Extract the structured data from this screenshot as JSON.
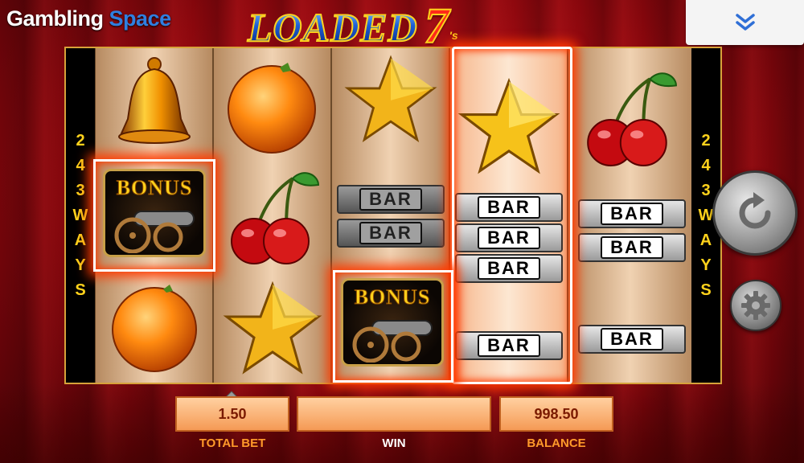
{
  "header": {
    "brand_word1": "Gambling",
    "brand_word2": "Space",
    "logo_word": "LOADED",
    "logo_seven": "7",
    "logo_suffix": "'s"
  },
  "ways": {
    "left": [
      "2",
      "4",
      "3",
      "W",
      "A",
      "Y",
      "S"
    ],
    "right": [
      "2",
      "4",
      "3",
      "W",
      "A",
      "Y",
      "S"
    ]
  },
  "reels": [
    {
      "symbols": [
        "bell",
        "bonus",
        "orange"
      ]
    },
    {
      "symbols": [
        "orange",
        "cherry",
        "star"
      ]
    },
    {
      "symbols": [
        "star",
        "bar-double",
        "bonus"
      ]
    },
    {
      "symbols": [
        "star",
        "bar-triple",
        "bar"
      ]
    },
    {
      "symbols": [
        "cherry",
        "bar-double",
        "bar"
      ]
    }
  ],
  "symbols": {
    "bonus_label": "BONUS",
    "bar_label": "BAR"
  },
  "bottom_bar": {
    "total_bet_value": "1.50",
    "total_bet_label": "TOTAL BET",
    "win_value": "",
    "win_label": "WIN",
    "balance_value": "998.50",
    "balance_label": "BALANCE"
  },
  "icons": {
    "menu": "chevron-double-down-icon",
    "spin": "refresh-arrow-icon",
    "settings": "gear-icon",
    "bet_up": "triangle-up-icon"
  },
  "colors": {
    "background": "#a80a12",
    "frame": "#d7a23a",
    "ways_text": "#ffd21c",
    "panel_fill": "#f59a55",
    "panel_text": "#7a1a00",
    "label_orange": "#ff9a2a",
    "highlight_glow": "#ff3a00",
    "brand_blue": "#2f7fe0"
  }
}
